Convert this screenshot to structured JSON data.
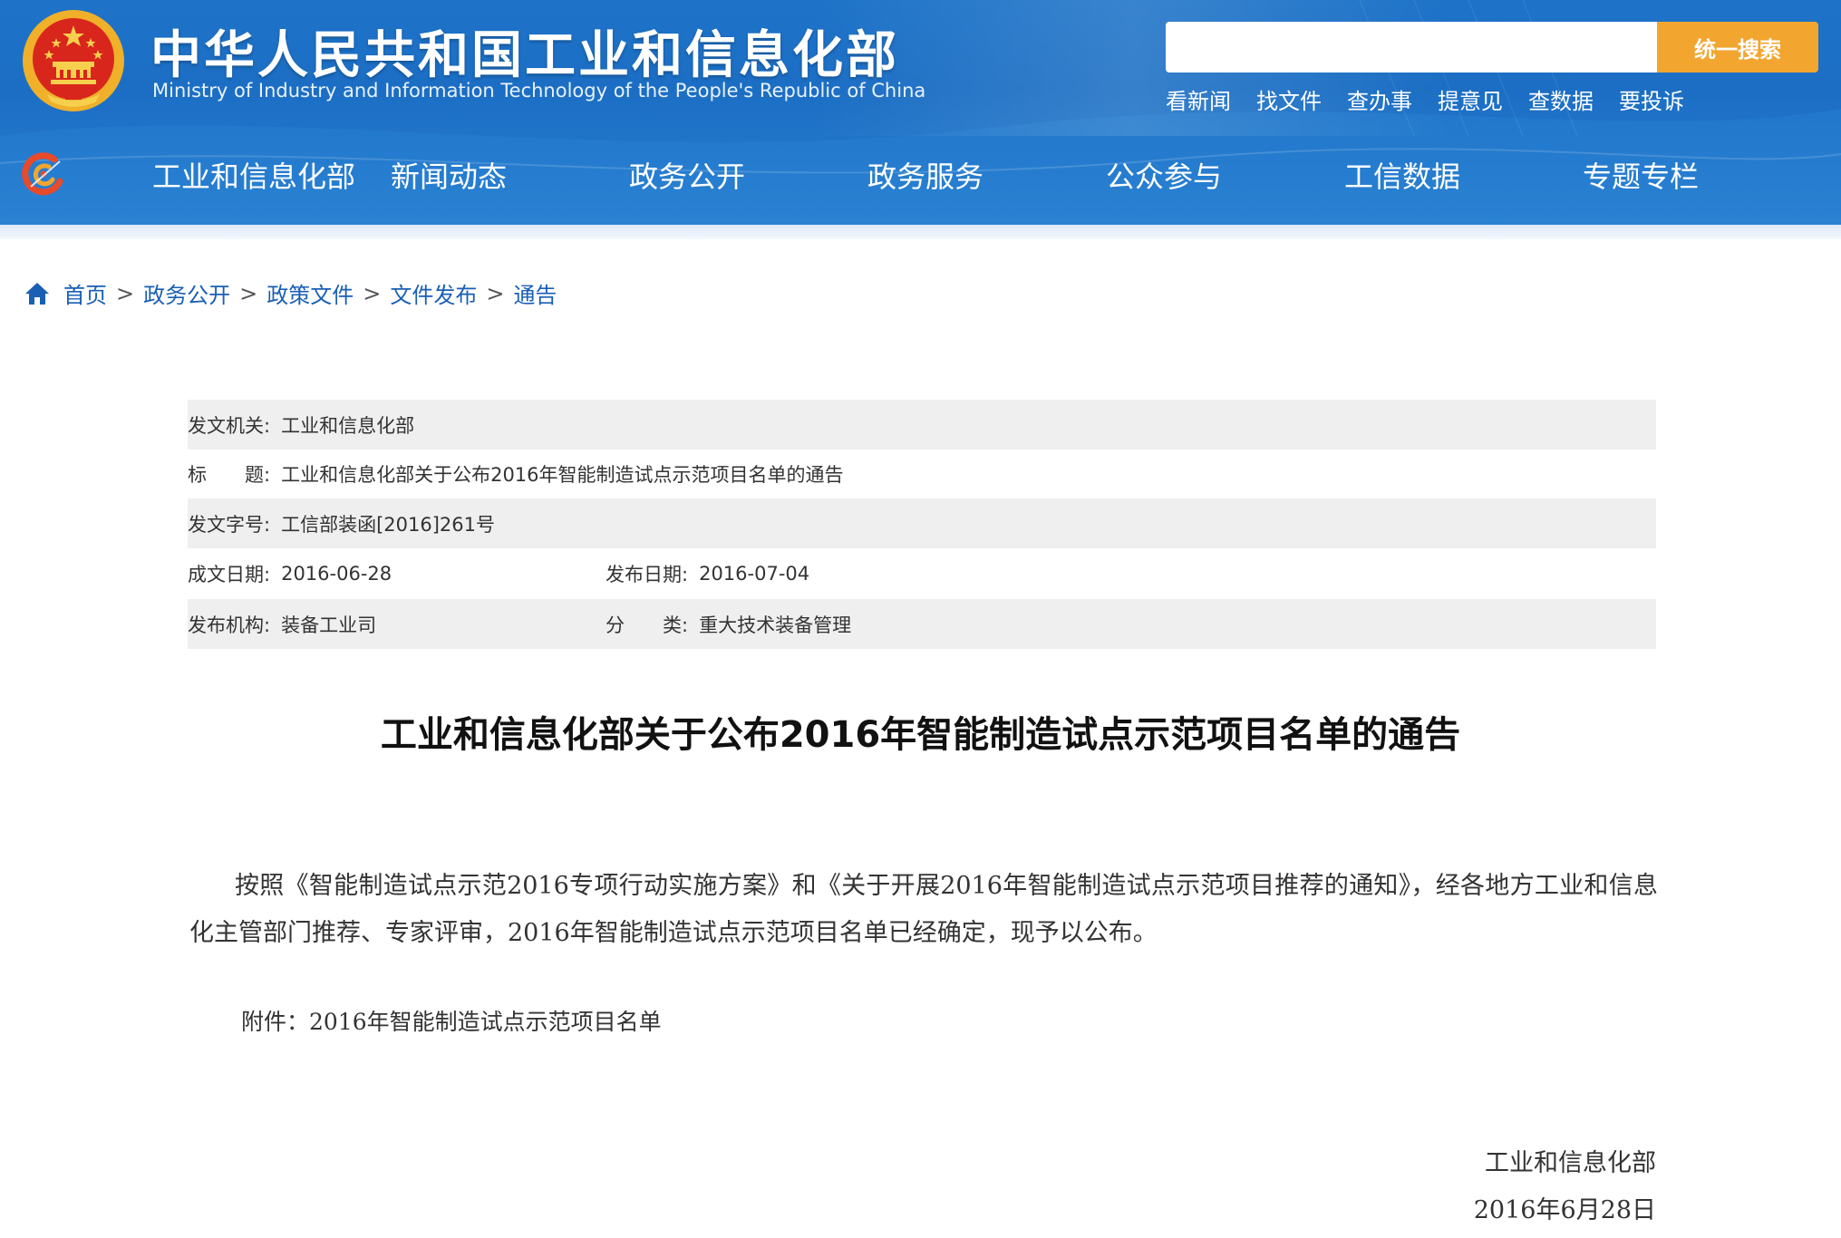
{
  "header": {
    "title": "中华人民共和国工业和信息化部",
    "subtitle": "Ministry of Industry and Information Technology of the People's Republic of China",
    "search": {
      "placeholder": "",
      "button_label": "统一搜索"
    },
    "quick_links": [
      "看新闻",
      "找文件",
      "查办事",
      "提意见",
      "查数据",
      "要投诉"
    ],
    "nav": [
      "工业和信息化部",
      "新闻动态",
      "政务公开",
      "政务服务",
      "公众参与",
      "工信数据",
      "专题专栏"
    ]
  },
  "breadcrumb": [
    "首页",
    "政务公开",
    "政策文件",
    "文件发布",
    "通告"
  ],
  "breadcrumb_sep": ">",
  "meta": {
    "issuer_label": "发文机关:",
    "issuer": "工业和信息化部",
    "title_label": "标　　题:",
    "title": "工业和信息化部关于公布2016年智能制造试点示范项目名单的通告",
    "doc_no_label": "发文字号:",
    "doc_no": "工信部装函[2016]261号",
    "written_date_label": "成文日期:",
    "written_date": "2016-06-28",
    "publish_date_label": "发布日期:",
    "publish_date": "2016-07-04",
    "publisher_label": "发布机构:",
    "publisher": "装备工业司",
    "category_label": "分　　类:",
    "category": "重大技术装备管理"
  },
  "article": {
    "title": "工业和信息化部关于公布2016年智能制造试点示范项目名单的通告",
    "body": "按照《智能制造试点示范2016专项行动实施方案》和《关于开展2016年智能制造试点示范项目推荐的通知》，经各地方工业和信息化主管部门推荐、专家评审，2016年智能制造试点示范项目名单已经确定，现予以公布。",
    "attachment_label": "附件：",
    "attachment_link": "2016年智能制造试点示范项目名单",
    "signature_org": "工业和信息化部",
    "signature_date": "2016年6月28日"
  },
  "colors": {
    "header_blue": "#1e73c8",
    "search_button": "#f2a630",
    "link_blue": "#1a5fb4",
    "meta_shade": "#efefef"
  },
  "icons": [
    "national-emblem-icon",
    "nav-logo-icon",
    "home-icon"
  ]
}
